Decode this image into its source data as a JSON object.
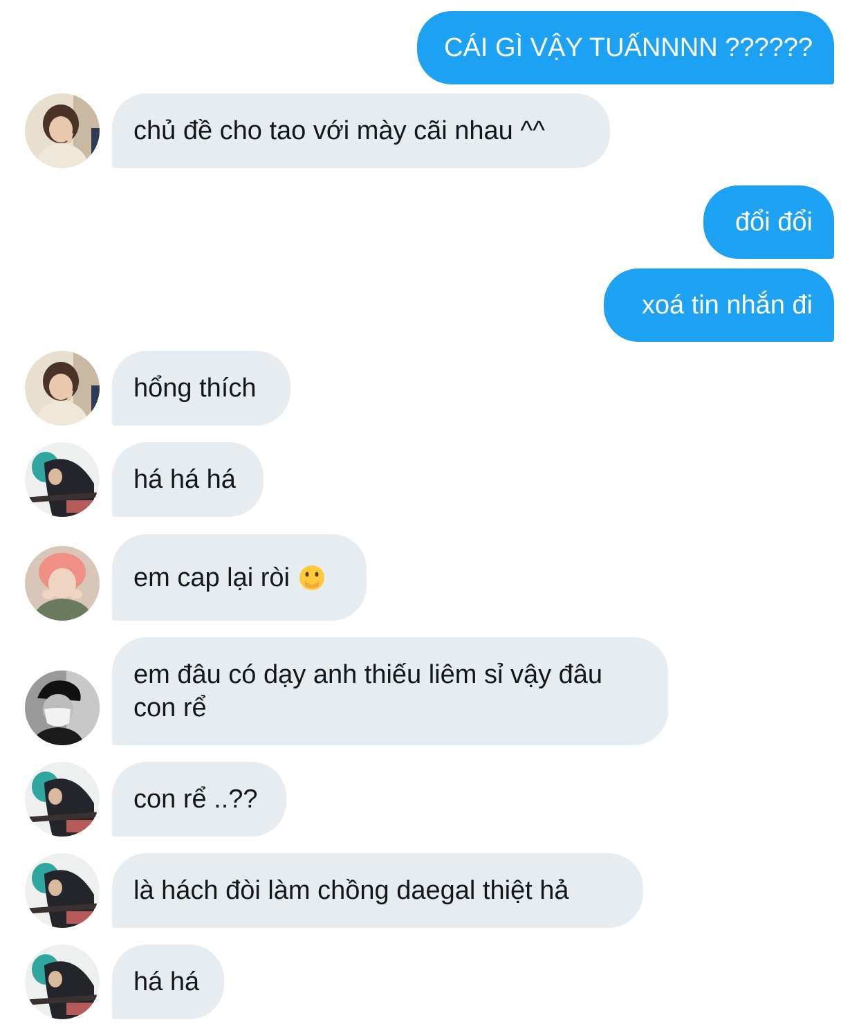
{
  "conversation": {
    "messages": [
      {
        "direction": "outgoing",
        "text": "CÁI GÌ VẬY TUẤNNNN ??????"
      },
      {
        "direction": "incoming",
        "text": "chủ đề cho tao với mày cãi nhau ^^",
        "avatar": "avatar-beige-sweater-peace-sign"
      },
      {
        "direction": "outgoing",
        "text": "đổi đổi"
      },
      {
        "direction": "outgoing",
        "text": "xoá tin nhắn đi"
      },
      {
        "direction": "incoming",
        "text": "hổng thích",
        "avatar": "avatar-beige-sweater-peace-sign"
      },
      {
        "direction": "incoming",
        "text": "há há há",
        "avatar": "avatar-teal-hair-guitar"
      },
      {
        "direction": "incoming",
        "text": "em cap lại ròi",
        "emoji": "🫢",
        "avatar": "avatar-pink-hair"
      },
      {
        "direction": "incoming",
        "text": "em đâu có dạy anh thiếu liêm sỉ vậy đâu\ncon rể",
        "avatar": "avatar-black-cap-mask"
      },
      {
        "direction": "incoming",
        "text": "con rể ..??",
        "avatar": "avatar-teal-hair-guitar"
      },
      {
        "direction": "incoming",
        "text": "là hách đòi làm chồng daegal thiệt hả",
        "avatar": "avatar-teal-hair-guitar"
      },
      {
        "direction": "incoming",
        "text": "há há",
        "avatar": "avatar-teal-hair-guitar"
      }
    ]
  },
  "colors": {
    "outgoing_bubble": "#1da1f2",
    "incoming_bubble": "#e6ecf0",
    "incoming_text": "#14171a",
    "outgoing_text": "#ffffff"
  }
}
